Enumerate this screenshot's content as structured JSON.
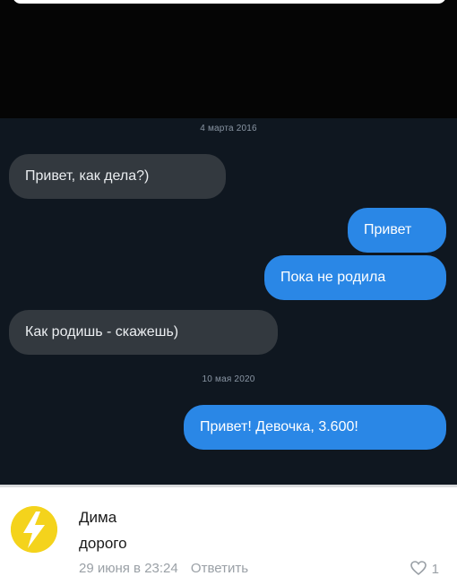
{
  "chat": {
    "date_1": "4 марта 2016",
    "date_2": "10 мая 2020",
    "messages": [
      {
        "side": "incoming",
        "text": "Привет, как дела?)"
      },
      {
        "side": "outgoing",
        "text": "Привет"
      },
      {
        "side": "outgoing",
        "text": "Пока не родила"
      },
      {
        "side": "incoming",
        "text": "Как родишь - скажешь)"
      },
      {
        "side": "outgoing",
        "text": "Привет! Девочка, 3.600!"
      }
    ],
    "colors": {
      "background": "#0f1720",
      "incoming_bubble": "#33393f",
      "outgoing_bubble": "#2a87e6"
    }
  },
  "comment": {
    "author": "Дима",
    "text": "дорого",
    "timestamp": "29 июня в 23:24",
    "reply_label": "Ответить",
    "likes": "1",
    "avatar_icon": "lightning-avatar-icon",
    "like_icon": "heart-icon",
    "avatar_color": "#f4d31c"
  }
}
